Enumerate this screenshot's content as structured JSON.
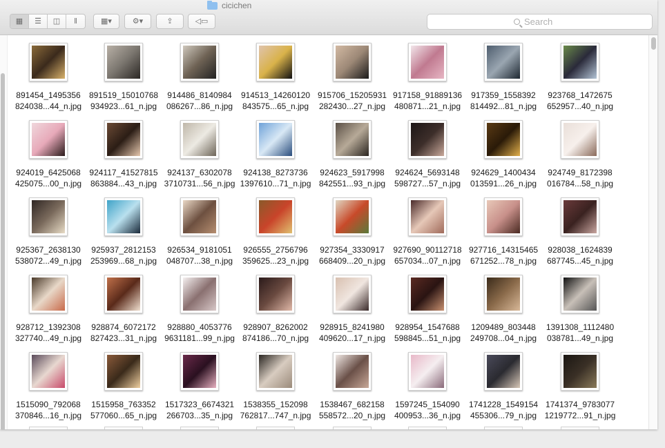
{
  "window": {
    "title": "cicichen"
  },
  "toolbar": {
    "view_icon": "grid-view-icon",
    "list_icon": "list-view-icon",
    "columns_icon": "columns-view-icon",
    "coverflow_icon": "cover-flow-icon",
    "arrange_icon": "arrange-grid-icon",
    "action_icon": "gear-icon",
    "share_icon": "share-icon",
    "tag_icon": "tag-icon"
  },
  "search": {
    "placeholder": "Search"
  },
  "files": [
    {
      "line1": "891454_1495356",
      "line2": "824038...44_n.jpg",
      "colors": [
        "#8a6a3a",
        "#d9b26b",
        "#3b2a1c"
      ]
    },
    {
      "line1": "891519_15010768",
      "line2": "934923...61_n.jpg",
      "colors": [
        "#b8b0a6",
        "#2b2724",
        "#7b766f"
      ]
    },
    {
      "line1": "914486_8140984",
      "line2": "086267...86_n.jpg",
      "colors": [
        "#cfc8bd",
        "#222",
        "#6e6254"
      ]
    },
    {
      "line1": "914513_14260120",
      "line2": "843575...65_n.jpg",
      "colors": [
        "#e0c4ad",
        "#111",
        "#d9b24a"
      ]
    },
    {
      "line1": "915706_15205931",
      "line2": "282430...27_n.jpg",
      "colors": [
        "#d2b9a3",
        "#1b1b1b",
        "#9c8876"
      ]
    },
    {
      "line1": "917158_91889136",
      "line2": "480871...21_n.jpg",
      "colors": [
        "#f2e6ea",
        "#e7b6c4",
        "#c07a90"
      ]
    },
    {
      "line1": "917359_1558392",
      "line2": "814492...81_n.jpg",
      "colors": [
        "#4e5d6e",
        "#1d2731",
        "#9aa6b1"
      ]
    },
    {
      "line1": "923768_1472675",
      "line2": "652957...40_n.jpg",
      "colors": [
        "#6a8a4a",
        "#b3c4d6",
        "#2a2a3a"
      ]
    },
    {
      "line1": "924019_6425068",
      "line2": "425075...00_n.jpg",
      "colors": [
        "#f0d7dc",
        "#2a1a1a",
        "#e7a9b9"
      ]
    },
    {
      "line1": "924117_41527815",
      "line2": "863884...43_n.jpg",
      "colors": [
        "#6b4a35",
        "#e7c8ae",
        "#2b1d15"
      ]
    },
    {
      "line1": "924137_6302078",
      "line2": "3710731...56_n.jpg",
      "colors": [
        "#bfb7a9",
        "#6d6558",
        "#edeae3"
      ]
    },
    {
      "line1": "924138_8273736",
      "line2": "1397610...71_n.jpg",
      "colors": [
        "#6fa2d8",
        "#2a4d7d",
        "#d8e8f5"
      ]
    },
    {
      "line1": "924623_5917998",
      "line2": "842551...93_n.jpg",
      "colors": [
        "#5b5046",
        "#2a2520",
        "#b7aa98"
      ]
    },
    {
      "line1": "924624_5693148",
      "line2": "598727...57_n.jpg",
      "colors": [
        "#1c1616",
        "#c9a99b",
        "#3d2e2a"
      ]
    },
    {
      "line1": "924629_1400434",
      "line2": "013591...26_n.jpg",
      "colors": [
        "#5a3a14",
        "#e3b04b",
        "#2a1a08"
      ]
    },
    {
      "line1": "924749_8172398",
      "line2": "016784...58_n.jpg",
      "colors": [
        "#e9dfd9",
        "#8a6a5a",
        "#f7f0ec"
      ]
    },
    {
      "line1": "925367_2638130",
      "line2": "538072...49_n.jpg",
      "colors": [
        "#2f2623",
        "#e8dcc6",
        "#7a6a5c"
      ]
    },
    {
      "line1": "925937_2812153",
      "line2": "253969...68_n.jpg",
      "colors": [
        "#3fa3c8",
        "#1a2a3a",
        "#b9e0ee"
      ]
    },
    {
      "line1": "926534_9181051",
      "line2": "048707...38_n.jpg",
      "colors": [
        "#ead8c6",
        "#b68e70",
        "#6d5040"
      ]
    },
    {
      "line1": "926555_2756796",
      "line2": "359625...23_n.jpg",
      "colors": [
        "#8a5a2a",
        "#e0c070",
        "#c9442a"
      ]
    },
    {
      "line1": "927354_3330917",
      "line2": "668409...20_n.jpg",
      "colors": [
        "#e0d6c2",
        "#5a7a3a",
        "#c84a2a"
      ]
    },
    {
      "line1": "927690_90112718",
      "line2": "657034...07_n.jpg",
      "colors": [
        "#4a2a2a",
        "#a06a5a",
        "#e6c8b8"
      ]
    },
    {
      "line1": "927716_14315465",
      "line2": "671252...78_n.jpg",
      "colors": [
        "#e8c8b8",
        "#4a2a22",
        "#c8908a"
      ]
    },
    {
      "line1": "928038_1624839",
      "line2": "687745...45_n.jpg",
      "colors": [
        "#6a3a3a",
        "#c9a6a0",
        "#3a2220"
      ]
    },
    {
      "line1": "928712_1392308",
      "line2": "327740...49_n.jpg",
      "colors": [
        "#4a3a2a",
        "#c86a4a",
        "#e8d8c8"
      ]
    },
    {
      "line1": "928874_6072172",
      "line2": "827423...31_n.jpg",
      "colors": [
        "#c0704a",
        "#f0e0d0",
        "#5a2a1a"
      ]
    },
    {
      "line1": "928880_4053776",
      "line2": "9631181...99_n.jpg",
      "colors": [
        "#f5f0f0",
        "#d8c8c8",
        "#8a7070"
      ]
    },
    {
      "line1": "928907_8262002",
      "line2": "874186...70_n.jpg",
      "colors": [
        "#2a1a1a",
        "#e0b8a8",
        "#6a4a40"
      ]
    },
    {
      "line1": "928915_8241980",
      "line2": "409620...17_n.jpg",
      "colors": [
        "#d8c0b0",
        "#3a2a2a",
        "#f0e6e0"
      ]
    },
    {
      "line1": "928954_1547688",
      "line2": "598845...51_n.jpg",
      "colors": [
        "#5a2a22",
        "#c89070",
        "#2a1412"
      ]
    },
    {
      "line1": "1209489_803448",
      "line2": "249708...04_n.jpg",
      "colors": [
        "#3a2a1a",
        "#d8b898",
        "#8a6a4a"
      ]
    },
    {
      "line1": "1391308_1112480",
      "line2": "038781...49_n.jpg",
      "colors": [
        "#111",
        "#555",
        "#c8c0b8"
      ]
    },
    {
      "line1": "1515090_792068",
      "line2": "370846...16_n.jpg",
      "colors": [
        "#5a4a5a",
        "#c84a6a",
        "#e8d8d0"
      ]
    },
    {
      "line1": "1515958_763352",
      "line2": "577060...65_n.jpg",
      "colors": [
        "#8a5a3a",
        "#f0d0a0",
        "#3a2a1a"
      ]
    },
    {
      "line1": "1517323_6674321",
      "line2": "266703...35_n.jpg",
      "colors": [
        "#6a2a4a",
        "#e8b0c0",
        "#2a1020"
      ]
    },
    {
      "line1": "1538355_152098",
      "line2": "762817...747_n.jpg",
      "colors": [
        "#2a2622",
        "#9a8a7a",
        "#d8ccc0"
      ]
    },
    {
      "line1": "1538467_682158",
      "line2": "558572...20_n.jpg",
      "colors": [
        "#f0e8e4",
        "#c8a898",
        "#6a5048"
      ]
    },
    {
      "line1": "1597245_154090",
      "line2": "400953...36_n.jpg",
      "colors": [
        "#e8b8c8",
        "#8a6a7a",
        "#f5eef0"
      ]
    },
    {
      "line1": "1741228_1549154",
      "line2": "455306...79_n.jpg",
      "colors": [
        "#4a4a5a",
        "#d8c8b8",
        "#2a2a30"
      ]
    },
    {
      "line1": "1741374_9783077",
      "line2": "1219772...91_n.jpg",
      "colors": [
        "#1a1612",
        "#8a7a5a",
        "#3a3026"
      ]
    }
  ]
}
